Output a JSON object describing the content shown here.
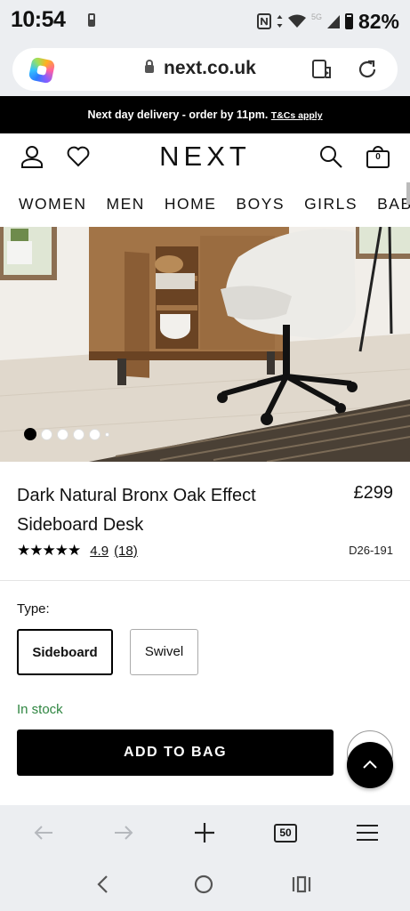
{
  "status_bar": {
    "time": "10:54",
    "network": "5G",
    "battery_percent": "82%"
  },
  "browser": {
    "url": "next.co.uk",
    "tab_count": "50"
  },
  "promo": {
    "text": "Next day delivery - order by 11pm.",
    "link": "T&Cs apply"
  },
  "header": {
    "logo": "NEXT",
    "bag_count": "0"
  },
  "nav": {
    "items": [
      "WOMEN",
      "MEN",
      "HOME",
      "BOYS",
      "GIRLS",
      "BABY"
    ]
  },
  "carousel": {
    "image_count": 6,
    "active_index": 0
  },
  "product": {
    "title": "Dark Natural Bronx Oak Effect Sideboard Desk",
    "price": "£299",
    "stars": "★★★★★",
    "rating": "4.9",
    "review_count": "(18)",
    "code": "D26-191"
  },
  "options": {
    "label": "Type:",
    "items": [
      {
        "label": "Sideboard",
        "selected": true
      },
      {
        "label": "Swivel",
        "selected": false
      }
    ]
  },
  "stock": {
    "status": "In stock"
  },
  "actions": {
    "add_to_bag": "ADD TO BAG"
  },
  "colors": {
    "promo_bg": "#000000",
    "stock_green": "#2e8540",
    "button_bg": "#000000",
    "chrome_bg": "#eceef1"
  }
}
